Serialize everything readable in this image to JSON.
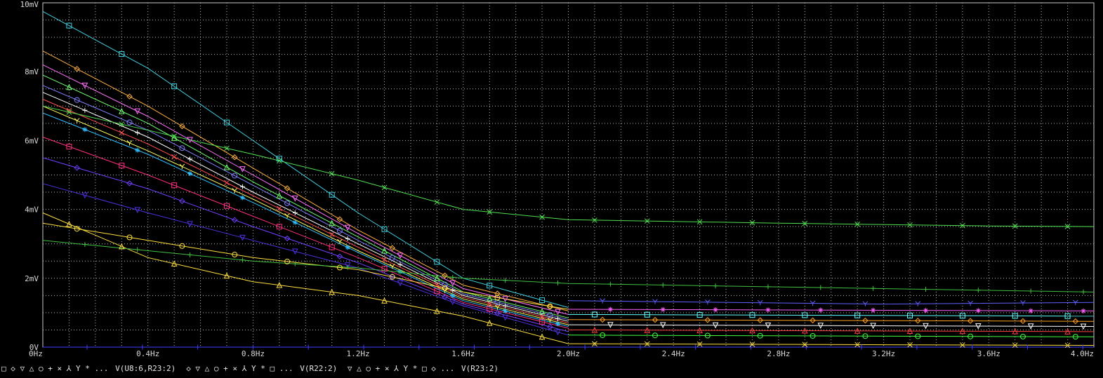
{
  "chart_data": {
    "type": "line",
    "x_unit": "Hz",
    "y_unit": "mV",
    "xlim": [
      0,
      4.0
    ],
    "ylim": [
      0,
      10
    ],
    "x_ticks": [
      "0Hz",
      "0.4Hz",
      "0.8Hz",
      "1.2Hz",
      "1.6Hz",
      "2.0Hz",
      "2.4Hz",
      "2.8Hz",
      "3.2Hz",
      "3.6Hz",
      "4.0Hz"
    ],
    "y_ticks": [
      "0V",
      "2mV",
      "4mV",
      "6mV",
      "8mV",
      "10mV"
    ],
    "grid": true,
    "legend_position": "bottom-left",
    "legend": [
      {
        "symbols": "□ ◇ ▽ △ ○ + × ⅄ Y * ...",
        "label": "V(U8:6,R23:2)"
      },
      {
        "symbols": "◇ ▽ △ ○ + × ⅄ Y * □ ...",
        "label": "V(R22:2)"
      },
      {
        "symbols": "▽ △ ○ + × ⅄ Y * □ ◇ ...",
        "label": "V(R23:2)"
      }
    ],
    "series": [
      {
        "color": "#40d0e0",
        "x": [
          0,
          0.4,
          0.8,
          1.2,
          1.6,
          2.0
        ],
        "y": [
          9.75,
          8.1,
          6.0,
          3.9,
          2.0,
          1.15
        ]
      },
      {
        "color": "#ffb040",
        "x": [
          0,
          0.4,
          0.8,
          1.2,
          1.6,
          2.0
        ],
        "y": [
          8.6,
          7.0,
          5.2,
          3.4,
          1.8,
          1.05
        ]
      },
      {
        "color": "#ff70ff",
        "x": [
          0,
          0.4,
          0.8,
          1.2,
          1.6,
          2.0
        ],
        "y": [
          8.2,
          6.7,
          5.0,
          3.3,
          1.7,
          0.95
        ]
      },
      {
        "color": "#70ff70",
        "x": [
          0,
          0.4,
          0.8,
          1.2,
          1.6,
          2.0
        ],
        "y": [
          7.9,
          6.5,
          4.8,
          3.2,
          1.6,
          0.85
        ]
      },
      {
        "color": "#8080ff",
        "x": [
          0,
          0.4,
          0.8,
          1.2,
          1.6,
          2.0
        ],
        "y": [
          7.6,
          6.3,
          4.7,
          3.1,
          1.55,
          0.8
        ]
      },
      {
        "color": "#ffffff",
        "x": [
          0,
          0.4,
          0.8,
          1.2,
          1.6,
          2.0
        ],
        "y": [
          7.4,
          6.1,
          4.5,
          3.0,
          1.5,
          0.75
        ]
      },
      {
        "color": "#ff5050",
        "x": [
          0,
          0.4,
          0.8,
          1.2,
          1.6,
          2.0
        ],
        "y": [
          7.2,
          5.9,
          4.4,
          2.9,
          1.45,
          0.7
        ]
      },
      {
        "color": "#ffff60",
        "x": [
          0,
          0.4,
          0.8,
          1.2,
          1.6,
          2.0
        ],
        "y": [
          7.0,
          5.7,
          4.3,
          2.8,
          1.4,
          0.65
        ]
      },
      {
        "color": "#30c0ff",
        "x": [
          0,
          0.4,
          0.8,
          1.2,
          1.6,
          2.0
        ],
        "y": [
          6.8,
          5.6,
          4.2,
          2.75,
          1.35,
          0.6
        ]
      },
      {
        "color": "#ff3080",
        "x": [
          0,
          0.4,
          0.8,
          1.2,
          1.6,
          2.0
        ],
        "y": [
          6.1,
          5.0,
          3.8,
          2.6,
          1.3,
          0.55
        ]
      },
      {
        "color": "#7040ff",
        "x": [
          0,
          0.4,
          0.8,
          1.2,
          1.6,
          2.0
        ],
        "y": [
          5.5,
          4.6,
          3.5,
          2.45,
          1.25,
          0.45
        ]
      },
      {
        "color": "#5030e0",
        "x": [
          0,
          0.4,
          0.8,
          1.2,
          1.6,
          2.0
        ],
        "y": [
          4.75,
          3.9,
          3.1,
          2.3,
          1.2,
          0.35
        ]
      },
      {
        "color": "#ffe040",
        "x": [
          0,
          0.4,
          0.8,
          1.2,
          1.6,
          2.0
        ],
        "y": [
          3.9,
          2.6,
          1.9,
          1.5,
          0.9,
          0.1
        ]
      },
      {
        "color": "#ffe040",
        "x": [
          0,
          0.4,
          0.8,
          1.2,
          1.6,
          2.0
        ],
        "y": [
          3.6,
          3.1,
          2.6,
          2.25,
          1.6,
          1.1
        ]
      },
      {
        "color": "#40c040",
        "x": [
          0,
          0.4,
          0.8,
          1.2,
          1.6,
          2.0,
          2.8,
          3.6,
          4.0
        ],
        "y": [
          3.1,
          2.8,
          2.5,
          2.3,
          2.0,
          1.85,
          1.75,
          1.65,
          1.6
        ]
      },
      {
        "color": "#50e050",
        "x": [
          0,
          0.4,
          0.8,
          1.2,
          1.6,
          2.0,
          2.8,
          3.6,
          4.0
        ],
        "y": [
          7.0,
          6.3,
          5.6,
          4.85,
          4.0,
          3.7,
          3.6,
          3.52,
          3.5
        ]
      },
      {
        "color": "#6060ff",
        "x": [
          2.0,
          3.2,
          4.0
        ],
        "y": [
          1.35,
          1.25,
          1.3
        ]
      },
      {
        "color": "#ff60ff",
        "x": [
          2.0,
          4.0
        ],
        "y": [
          1.1,
          1.05
        ]
      },
      {
        "color": "#60ffff",
        "x": [
          2.0,
          4.0
        ],
        "y": [
          0.95,
          0.9
        ]
      },
      {
        "color": "#ffa020",
        "x": [
          2.0,
          4.0
        ],
        "y": [
          0.8,
          0.75
        ]
      },
      {
        "color": "#ffffff",
        "x": [
          2.0,
          4.0
        ],
        "y": [
          0.65,
          0.6
        ]
      },
      {
        "color": "#ff4040",
        "x": [
          2.0,
          4.0
        ],
        "y": [
          0.5,
          0.45
        ]
      },
      {
        "color": "#40ff40",
        "x": [
          2.0,
          4.0
        ],
        "y": [
          0.35,
          0.3
        ]
      },
      {
        "color": "#4040ff",
        "x": [
          0,
          4.0
        ],
        "y": [
          0.0,
          0.0
        ]
      },
      {
        "color": "#ffe040",
        "x": [
          2.0,
          4.0
        ],
        "y": [
          0.1,
          0.05
        ]
      }
    ]
  }
}
